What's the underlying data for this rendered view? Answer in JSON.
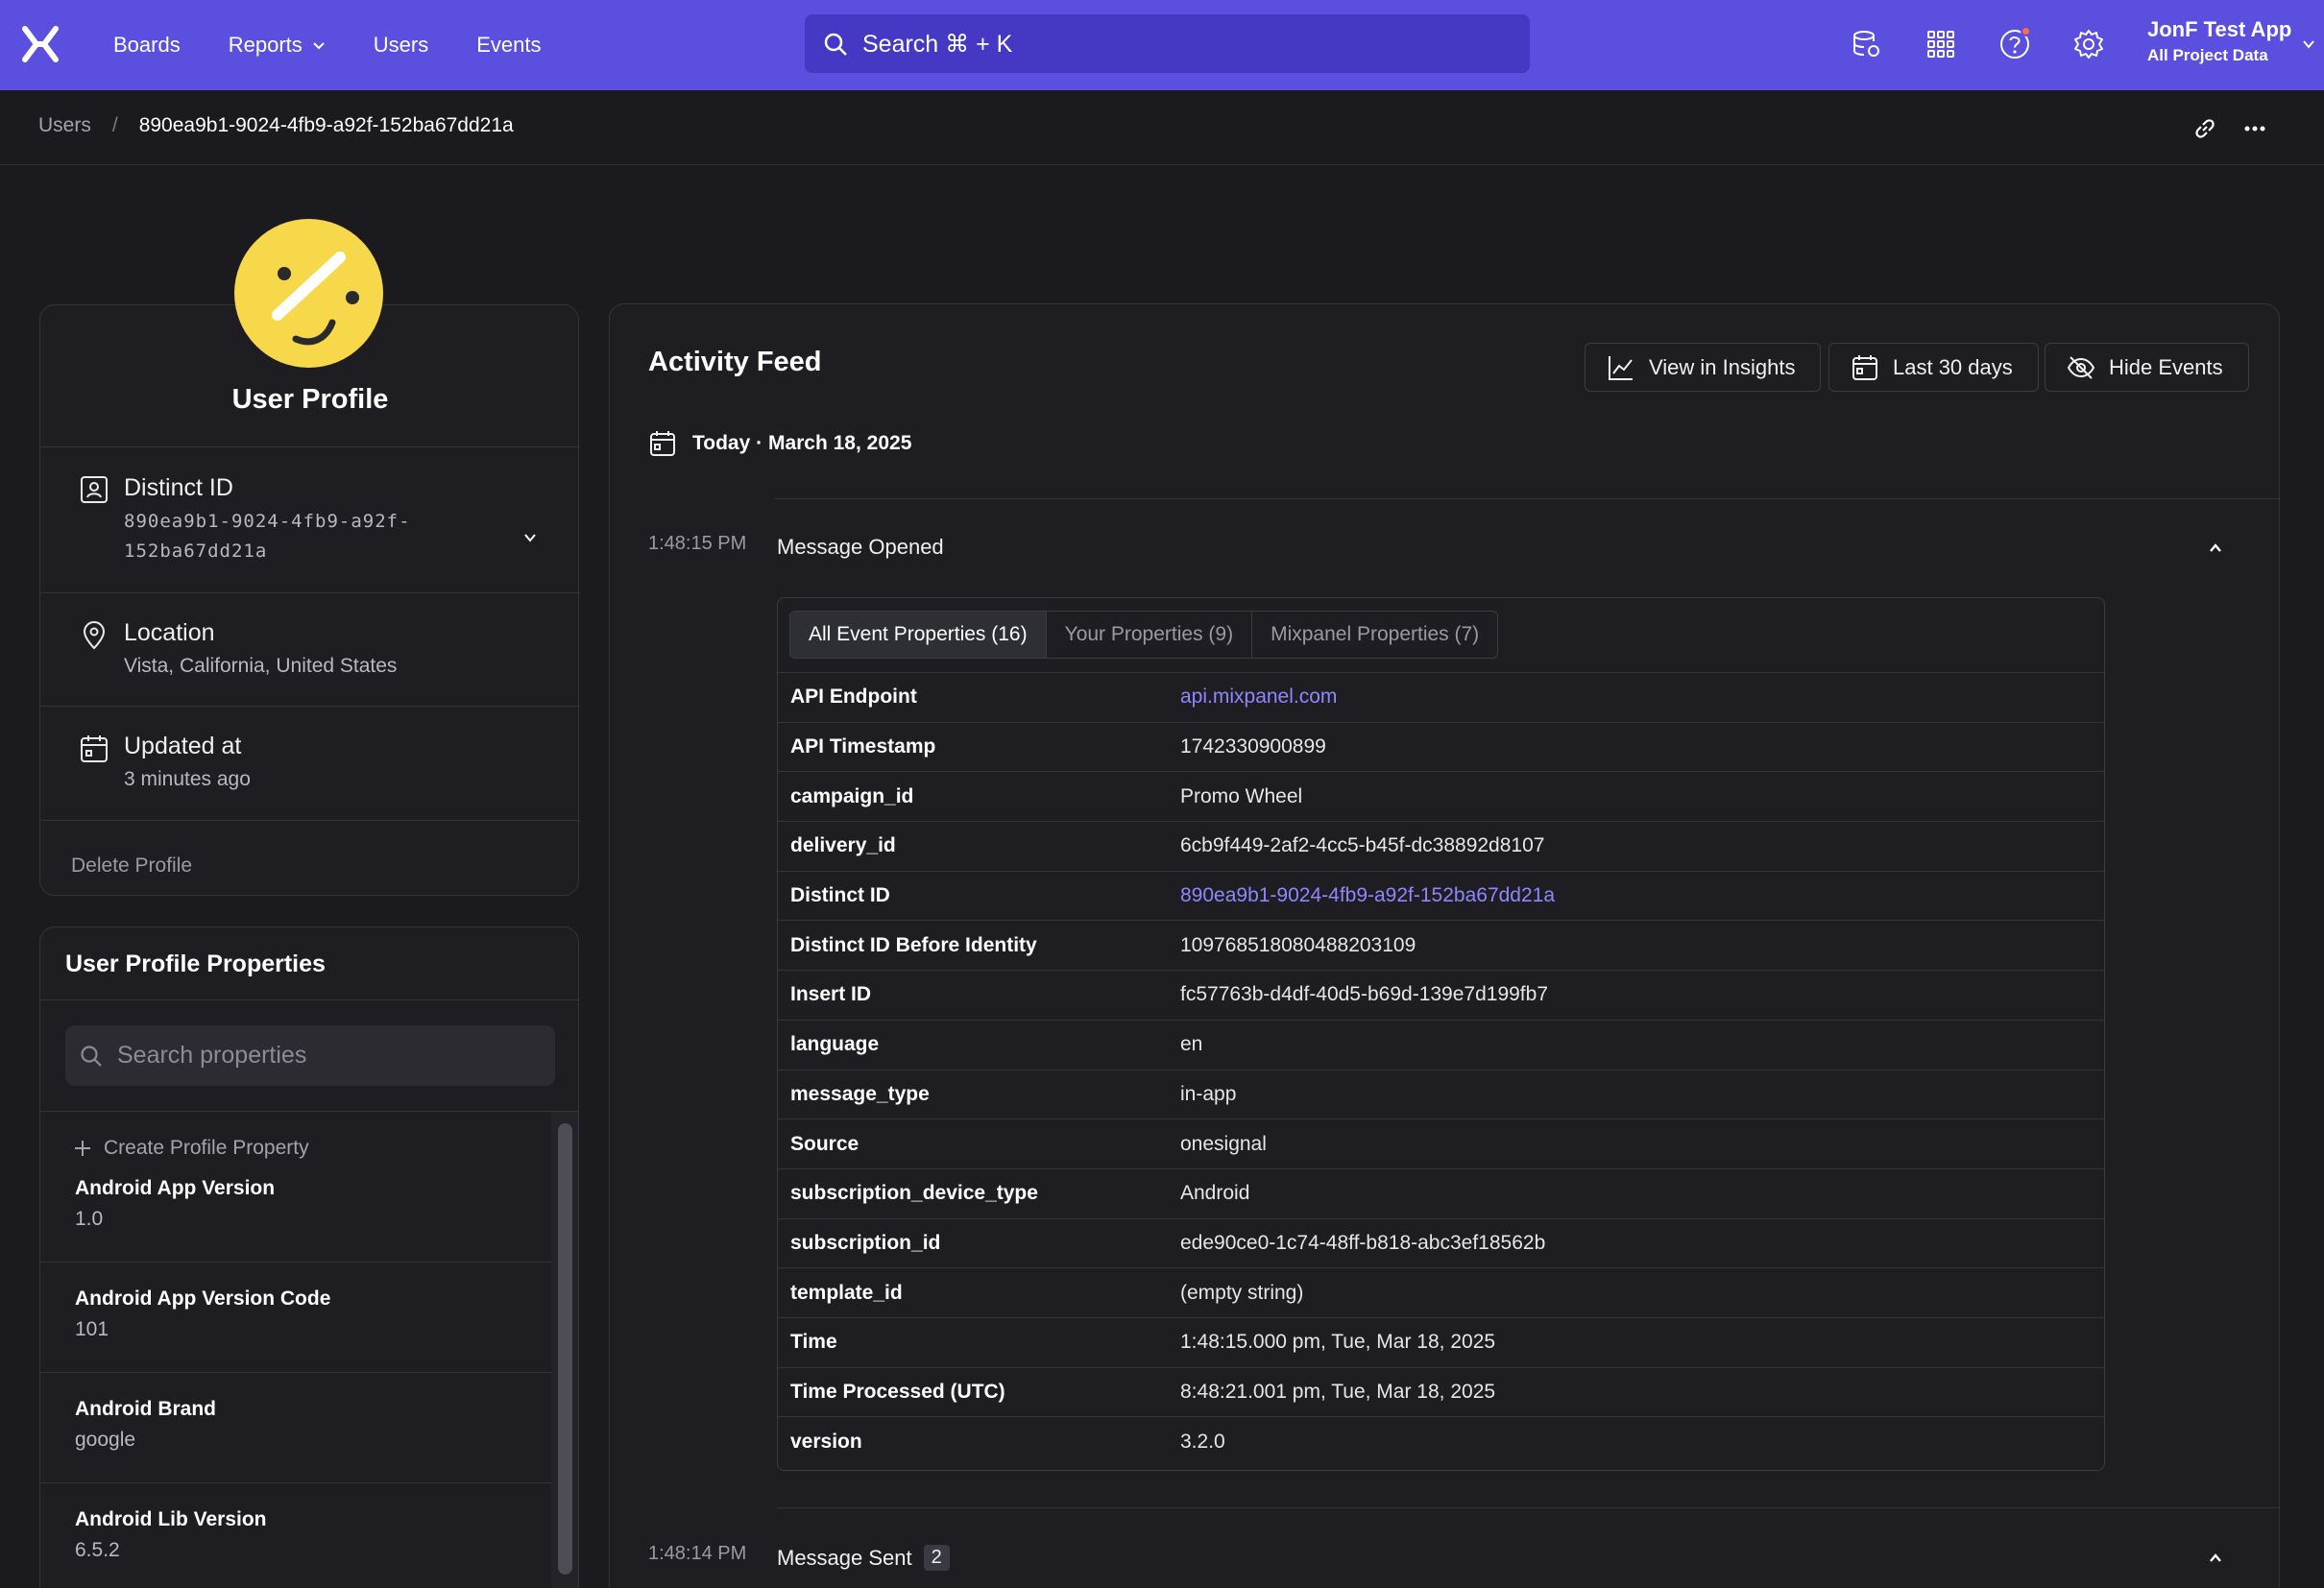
{
  "nav": {
    "links": [
      "Boards",
      "Reports",
      "Users",
      "Events"
    ],
    "search_label": "Search  ⌘ + K",
    "account_name": "JonF Test App",
    "account_project": "All Project Data"
  },
  "breadcrumb": {
    "parent": "Users",
    "separator": "/",
    "current": "890ea9b1-9024-4fb9-a92f-152ba67dd21a"
  },
  "profile": {
    "title": "User Profile",
    "distinct_label": "Distinct ID",
    "distinct_value": "890ea9b1-9024-4fb9-a92f-152ba67dd21a",
    "location_label": "Location",
    "location_value": "Vista, California, United States",
    "updated_label": "Updated at",
    "updated_value": "3 minutes ago",
    "delete_label": "Delete Profile"
  },
  "properties": {
    "title": "User Profile Properties",
    "search_placeholder": "Search properties",
    "create_label": "Create Profile Property",
    "items": [
      {
        "name": "Android App Version",
        "value": "1.0"
      },
      {
        "name": "Android App Version Code",
        "value": "101"
      },
      {
        "name": "Android Brand",
        "value": "google"
      },
      {
        "name": "Android Lib Version",
        "value": "6.5.2"
      }
    ]
  },
  "feed": {
    "title": "Activity Feed",
    "view_insights": "View in Insights",
    "date_range": "Last 30 days",
    "hide_events": "Hide Events",
    "date_label": "Today · March 18, 2025",
    "events": [
      {
        "time": "1:48:15 PM",
        "name": "Message Opened"
      },
      {
        "time": "1:48:14 PM",
        "name": "Message Sent",
        "count": "2"
      }
    ],
    "tabs": [
      "All Event Properties (16)",
      "Your Properties (9)",
      "Mixpanel Properties (7)"
    ],
    "rows": [
      {
        "key": "API Endpoint",
        "value": "api.mixpanel.com",
        "link": true
      },
      {
        "key": "API Timestamp",
        "value": "1742330900899"
      },
      {
        "key": "campaign_id",
        "value": "Promo Wheel"
      },
      {
        "key": "delivery_id",
        "value": "6cb9f449-2af2-4cc5-b45f-dc38892d8107"
      },
      {
        "key": "Distinct ID",
        "value": "890ea9b1-9024-4fb9-a92f-152ba67dd21a",
        "link": true
      },
      {
        "key": "Distinct ID Before Identity",
        "value": "109768518080488203109"
      },
      {
        "key": "Insert ID",
        "value": "fc57763b-d4df-40d5-b69d-139e7d199fb7"
      },
      {
        "key": "language",
        "value": "en"
      },
      {
        "key": "message_type",
        "value": "in-app"
      },
      {
        "key": "Source",
        "value": "onesignal"
      },
      {
        "key": "subscription_device_type",
        "value": "Android"
      },
      {
        "key": "subscription_id",
        "value": "ede90ce0-1c74-48ff-b818-abc3ef18562b"
      },
      {
        "key": "template_id",
        "value": "(empty string)"
      },
      {
        "key": "Time",
        "value": "1:48:15.000 pm, Tue, Mar 18, 2025"
      },
      {
        "key": "Time Processed (UTC)",
        "value": "8:48:21.001 pm, Tue, Mar 18, 2025"
      },
      {
        "key": "version",
        "value": "3.2.0"
      }
    ]
  },
  "colors": {
    "brand": "#5b4fe0",
    "avatar": "#f7d84a",
    "link": "#8f86ff"
  }
}
